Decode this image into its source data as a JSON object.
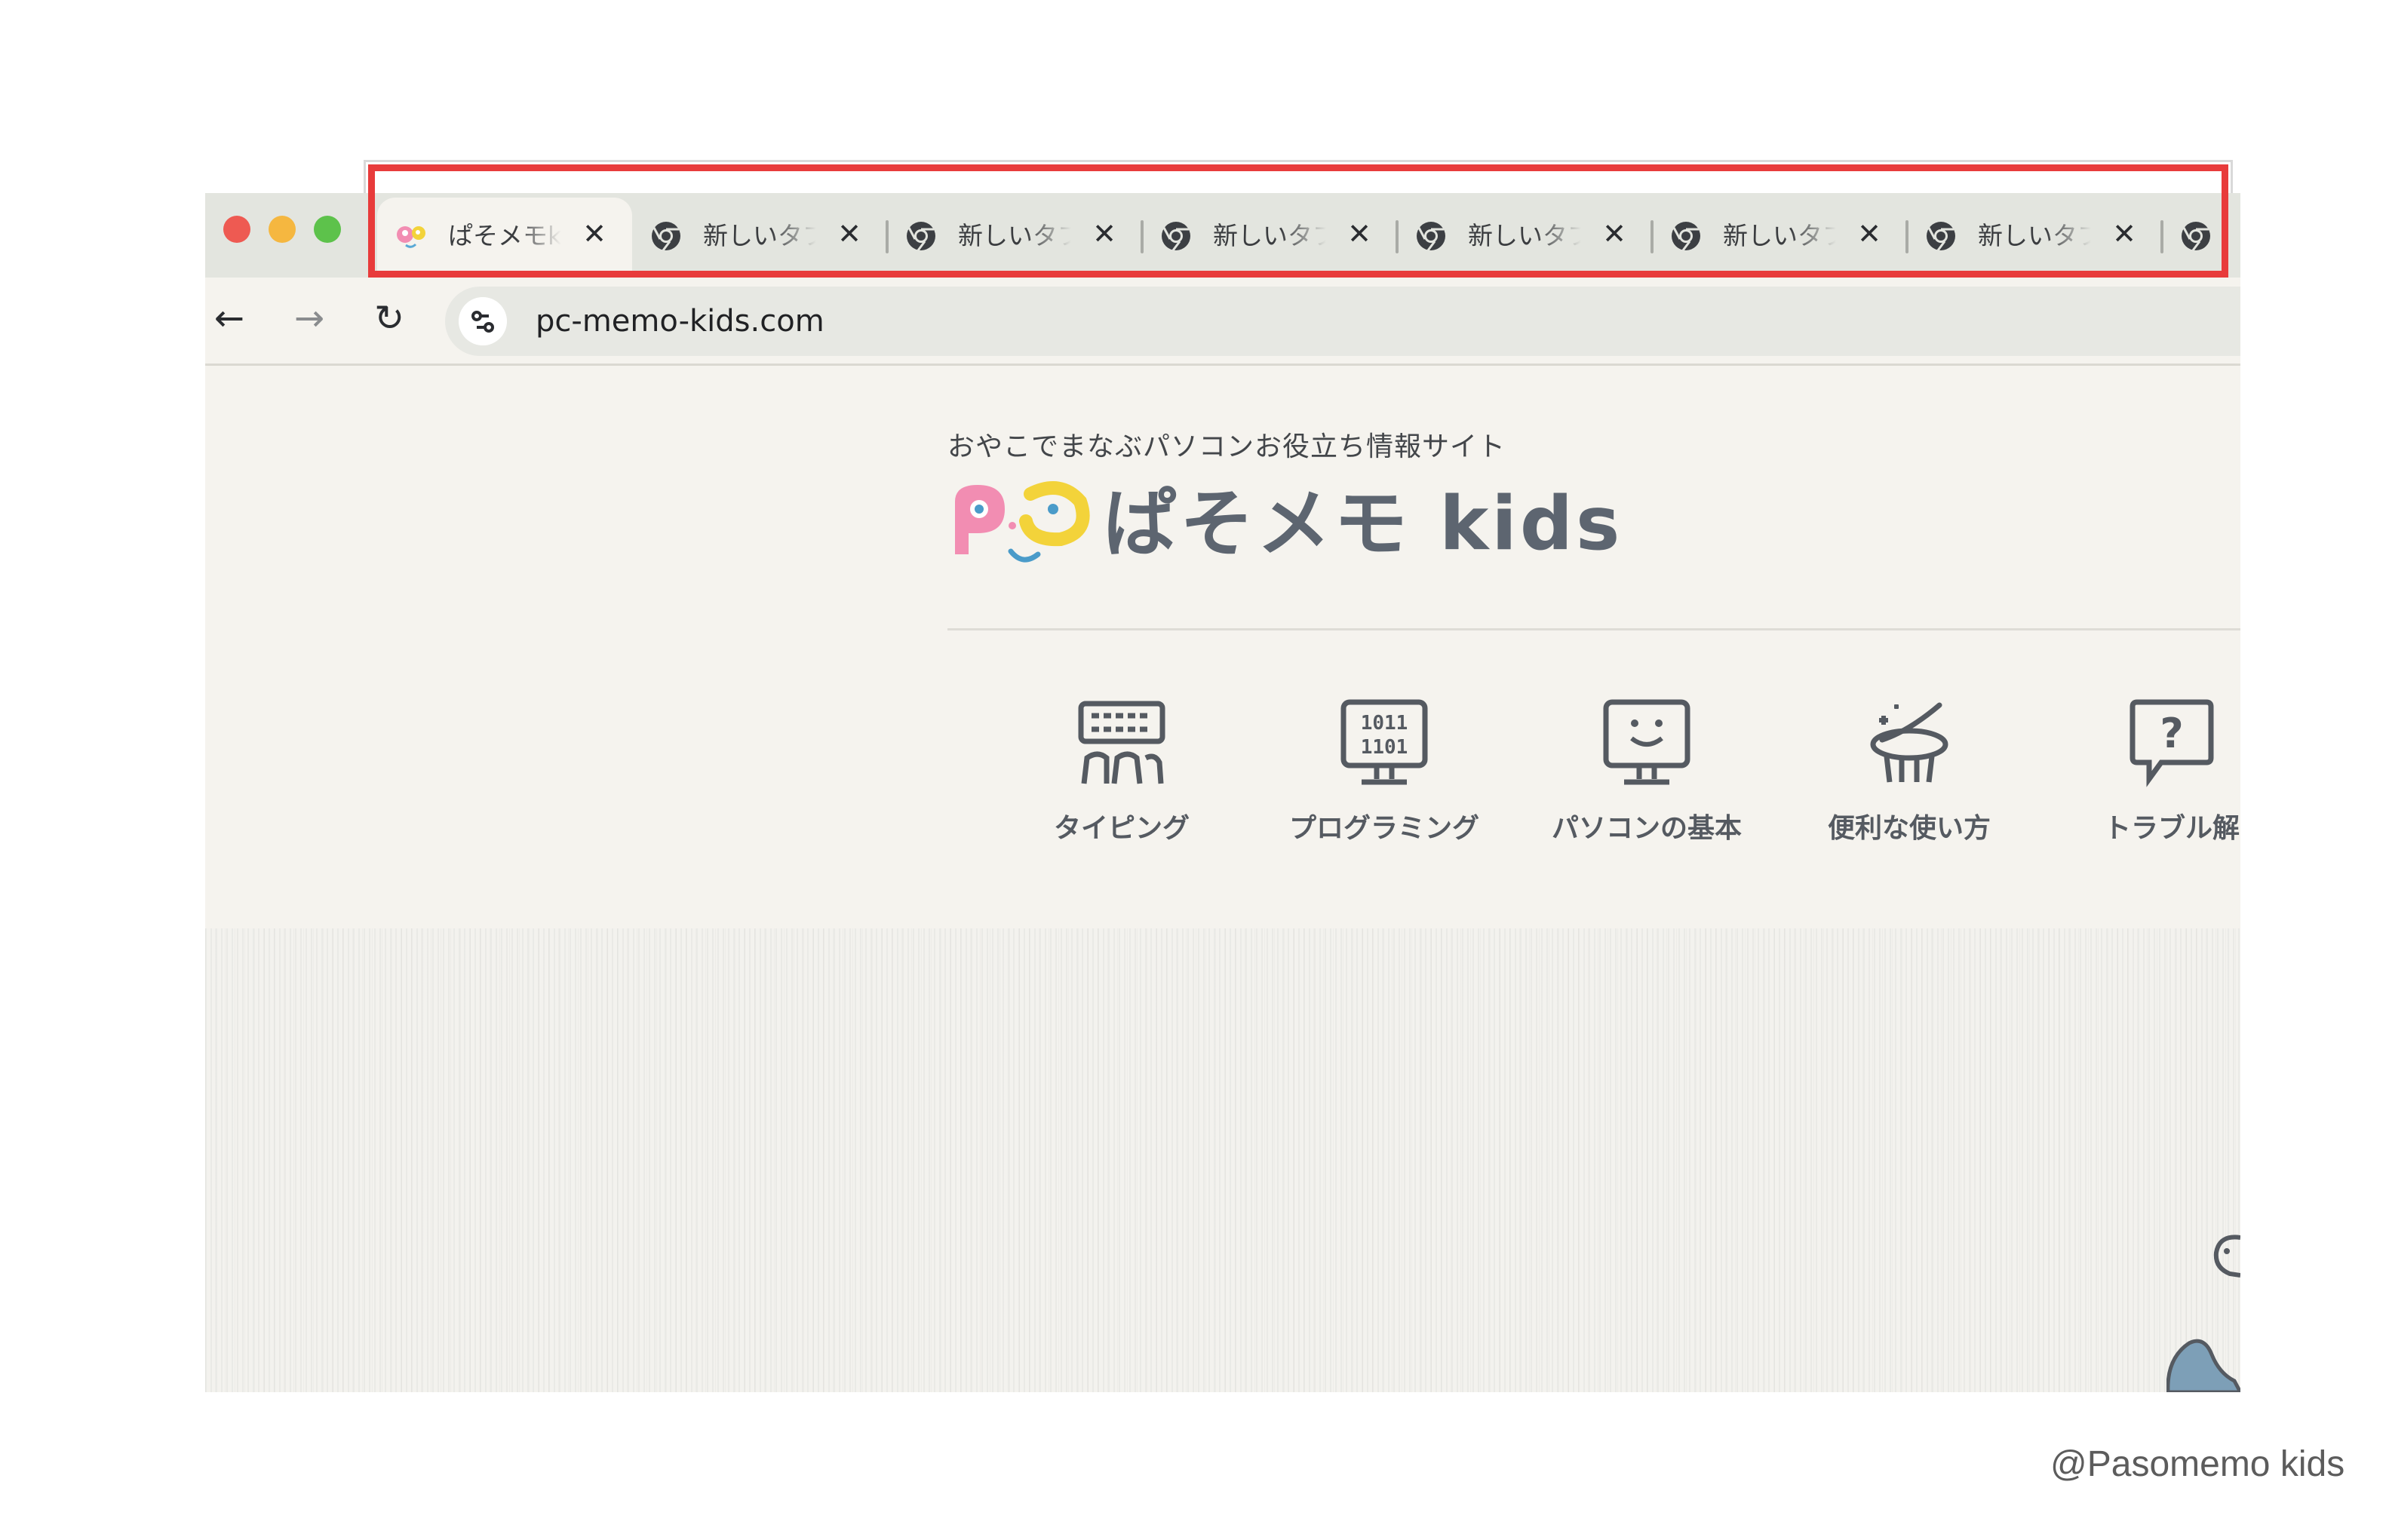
{
  "browser": {
    "tabs": [
      {
        "title": "ぱそメモkids",
        "active": true,
        "icon": "pasomemo-favicon"
      },
      {
        "title": "新しいタブ",
        "active": false,
        "icon": "chrome-icon"
      },
      {
        "title": "新しいタブ",
        "active": false,
        "icon": "chrome-icon"
      },
      {
        "title": "新しいタブ",
        "active": false,
        "icon": "chrome-icon"
      },
      {
        "title": "新しいタブ",
        "active": false,
        "icon": "chrome-icon"
      },
      {
        "title": "新しいタブ",
        "active": false,
        "icon": "chrome-icon"
      },
      {
        "title": "新しいタブ",
        "active": false,
        "icon": "chrome-icon"
      },
      {
        "title": "",
        "active": false,
        "icon": "chrome-icon"
      }
    ],
    "url": "pc-memo-kids.com",
    "highlight_color": "#e83b3b"
  },
  "site": {
    "tagline": "おやこでまなぶパソコンお役立ち情報サイト",
    "logo_text": "ぱそメモ kids",
    "nav": [
      {
        "label": "タイピング",
        "icon": "typing-icon"
      },
      {
        "label": "プログラミング",
        "icon": "programming-icon"
      },
      {
        "label": "パソコンの基本",
        "icon": "pc-basics-icon"
      },
      {
        "label": "便利な使い方",
        "icon": "tips-icon"
      },
      {
        "label": "トラブル解",
        "icon": "trouble-icon"
      }
    ]
  },
  "watermark": "@Pasomemo kids"
}
